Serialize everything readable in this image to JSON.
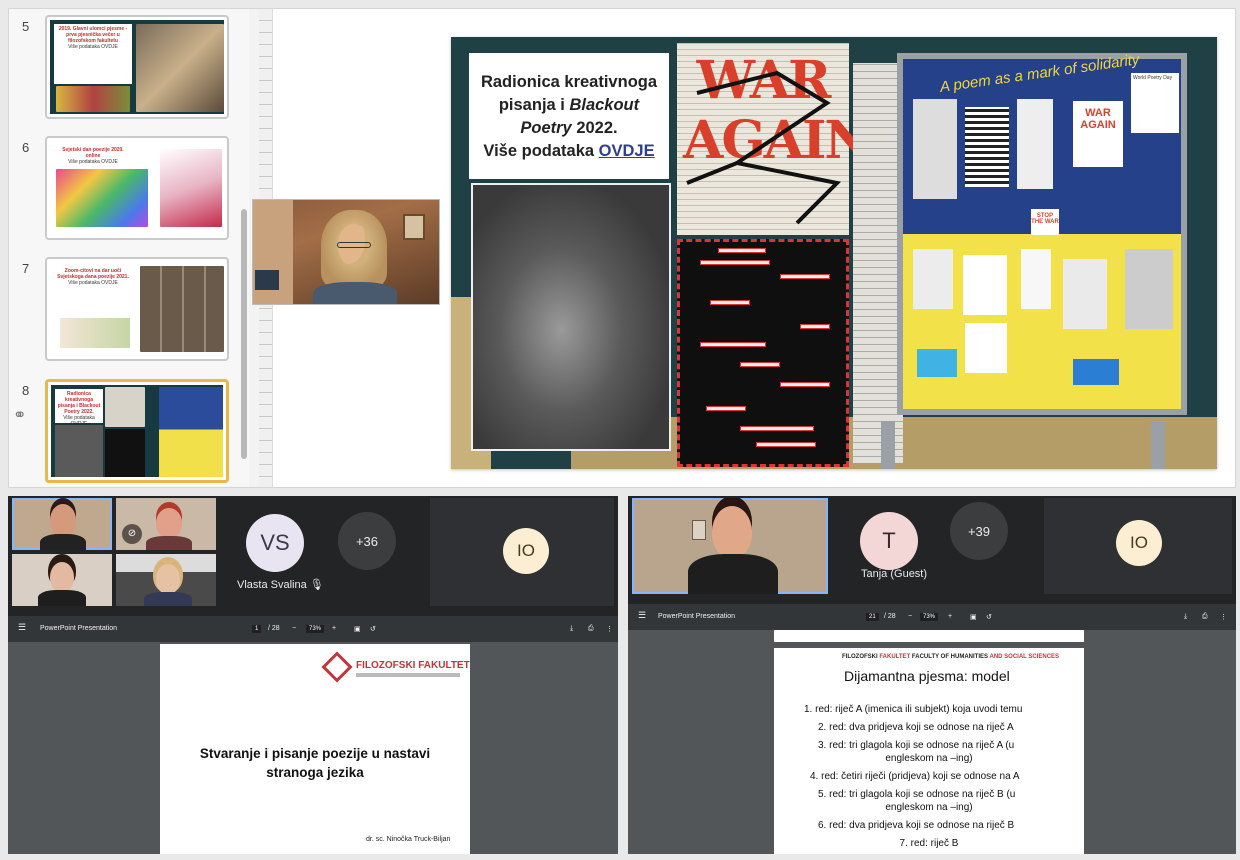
{
  "ppt": {
    "thumbnails": [
      {
        "num": "5",
        "title": "2019. Glavni ulomci pjesme - prva pjesnička večer u filozofskom fakultetu",
        "sub": "Više podataka OVDJE"
      },
      {
        "num": "6",
        "title": "Svjetski dan poezije 2020. online",
        "sub": "Više podataka OVDJE"
      },
      {
        "num": "7",
        "title": "Zoom-citovi na dar uoči Svjetskoga dana poezije 2021.",
        "sub": "Više podataka OVDJE"
      },
      {
        "num": "8",
        "title": "Radionica kreativnoga pisanja i Blackout Poetry 2022.",
        "sub": "Više podataka OVDJE"
      }
    ],
    "slide": {
      "title_line1": "Radionica kreativnoga",
      "title_line2a": "pisanja i ",
      "title_italic1": "Blackout",
      "title_italic2": "Poetry",
      "title_line3b": " 2022.",
      "more_text": "Više podataka ",
      "link": "OVDJE",
      "war_text": "WAR AGAIN",
      "board_heading": "A poem as a mark of solidarity",
      "board_corner": "World Poetry Day",
      "board_sign": "STOP THE WAR"
    }
  },
  "meet_left": {
    "avatar_initials": "VS",
    "avatar_name": "Vlasta Svalina",
    "more_count": "+36",
    "io_initials": "IO",
    "pdf": {
      "title": "PowerPoint Presentation",
      "page": "1",
      "pages": "/ 28",
      "zoom": "73%",
      "brand_a": "FILOZOFSKI",
      "brand_b": "FAKULTET",
      "slide_title": "Stvaranje i pisanje poezije u nastavi stranoga jezika",
      "author": "dr. sc. Ninočka Truck-Biljan"
    }
  },
  "meet_right": {
    "avatar_initial": "T",
    "avatar_name": "Tanja (Guest)",
    "more_count": "+39",
    "io_initials": "IO",
    "pdf": {
      "title": "PowerPoint Presentation",
      "page": "21",
      "pages": "/ 28",
      "zoom": "73%",
      "brand_a": "FILOZOFSKI",
      "brand_b": "FAKULTET",
      "brand_c": "FACULTY OF HUMANITIES",
      "brand_d": "AND SOCIAL SCIENCES",
      "heading": "Dijamantna pjesma: model",
      "items": [
        "1.   red: riječ A (imenica ili subjekt) koja uvodi temu",
        "2.   red: dva pridjeva koji se odnose na riječ A",
        "3.   red: tri glagola koji se odnose na riječ A (u",
        "engleskom na –ing)",
        "4.   red: četiri riječi (pridjeva) koji se odnose na A",
        "5.   red: tri glagola koji se odnose na riječ B (u",
        "engleskom na –ing)",
        "6.   red: dva pridjeva koji se odnose na riječ B",
        "7.   red: riječ B"
      ]
    }
  },
  "colors": {
    "selected_thumb": "#e8b94a",
    "meet_bg": "#232425",
    "avatar_vs": "#e9e4f2",
    "avatar_io": "#fbeed2",
    "avatar_t": "#f3d7d7",
    "war_red": "#d8402c"
  }
}
